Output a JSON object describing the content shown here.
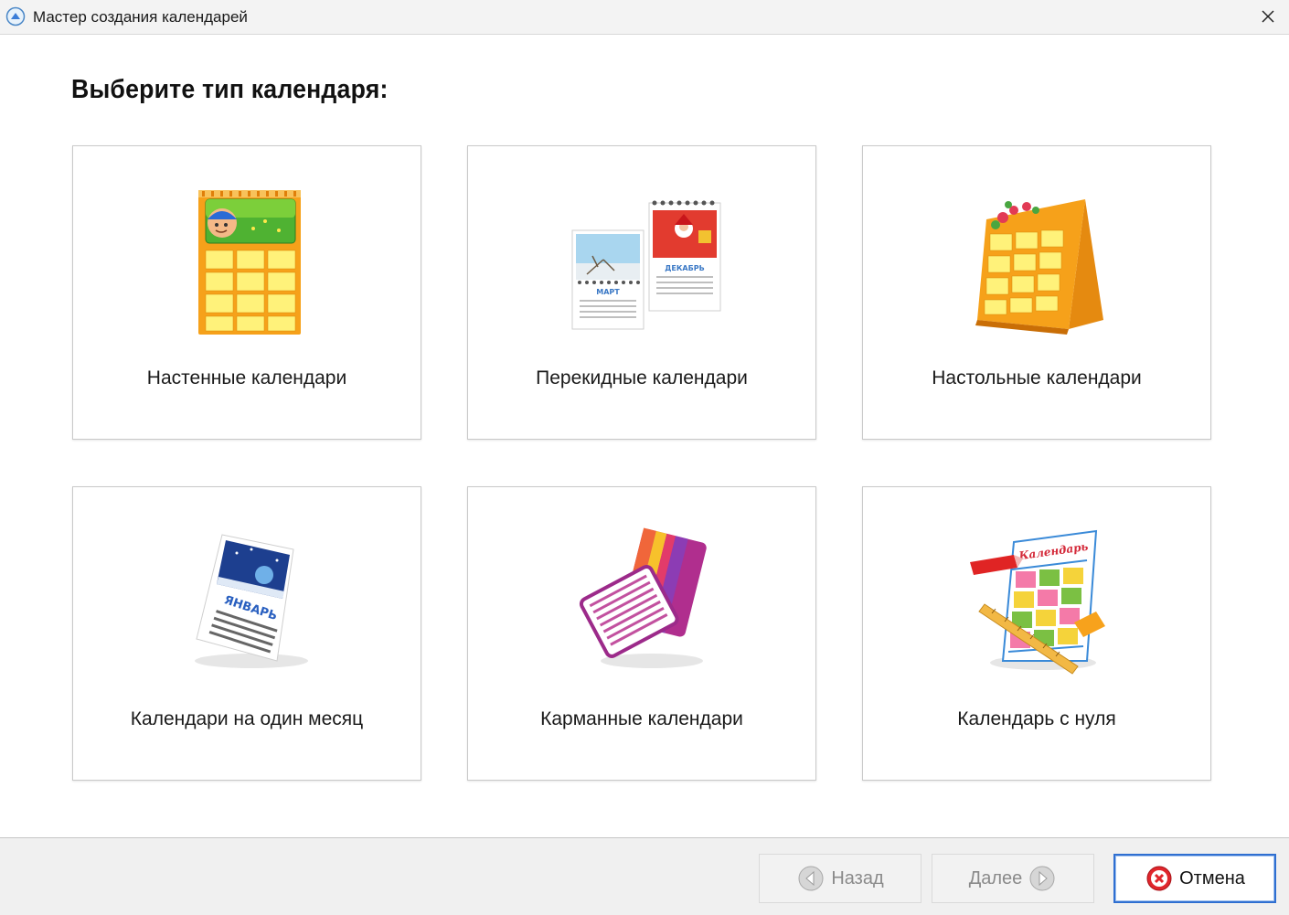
{
  "window": {
    "title": "Мастер создания календарей"
  },
  "main": {
    "heading": "Выберите тип календаря:",
    "tiles": [
      {
        "label": "Настенные календари",
        "icon": "wall-calendar-icon"
      },
      {
        "label": "Перекидные календари",
        "icon": "flip-calendar-icon",
        "image_text": [
          "МАРТ",
          "ДЕКАБРЬ"
        ]
      },
      {
        "label": "Настольные календари",
        "icon": "desk-calendar-icon"
      },
      {
        "label": "Календари на один месяц",
        "icon": "monthly-calendar-icon",
        "image_text": [
          "ЯНВАРЬ"
        ]
      },
      {
        "label": "Карманные календари",
        "icon": "pocket-calendar-icon"
      },
      {
        "label": "Календарь с нуля",
        "icon": "blank-calendar-icon",
        "image_text": [
          "Календарь"
        ]
      }
    ]
  },
  "footer": {
    "back_label": "Назад",
    "next_label": "Далее",
    "cancel_label": "Отмена"
  },
  "colors": {
    "accent_border": "#2f6fd1",
    "cancel_icon": "#e0262c",
    "calendar_orange": "#f6a11a"
  }
}
